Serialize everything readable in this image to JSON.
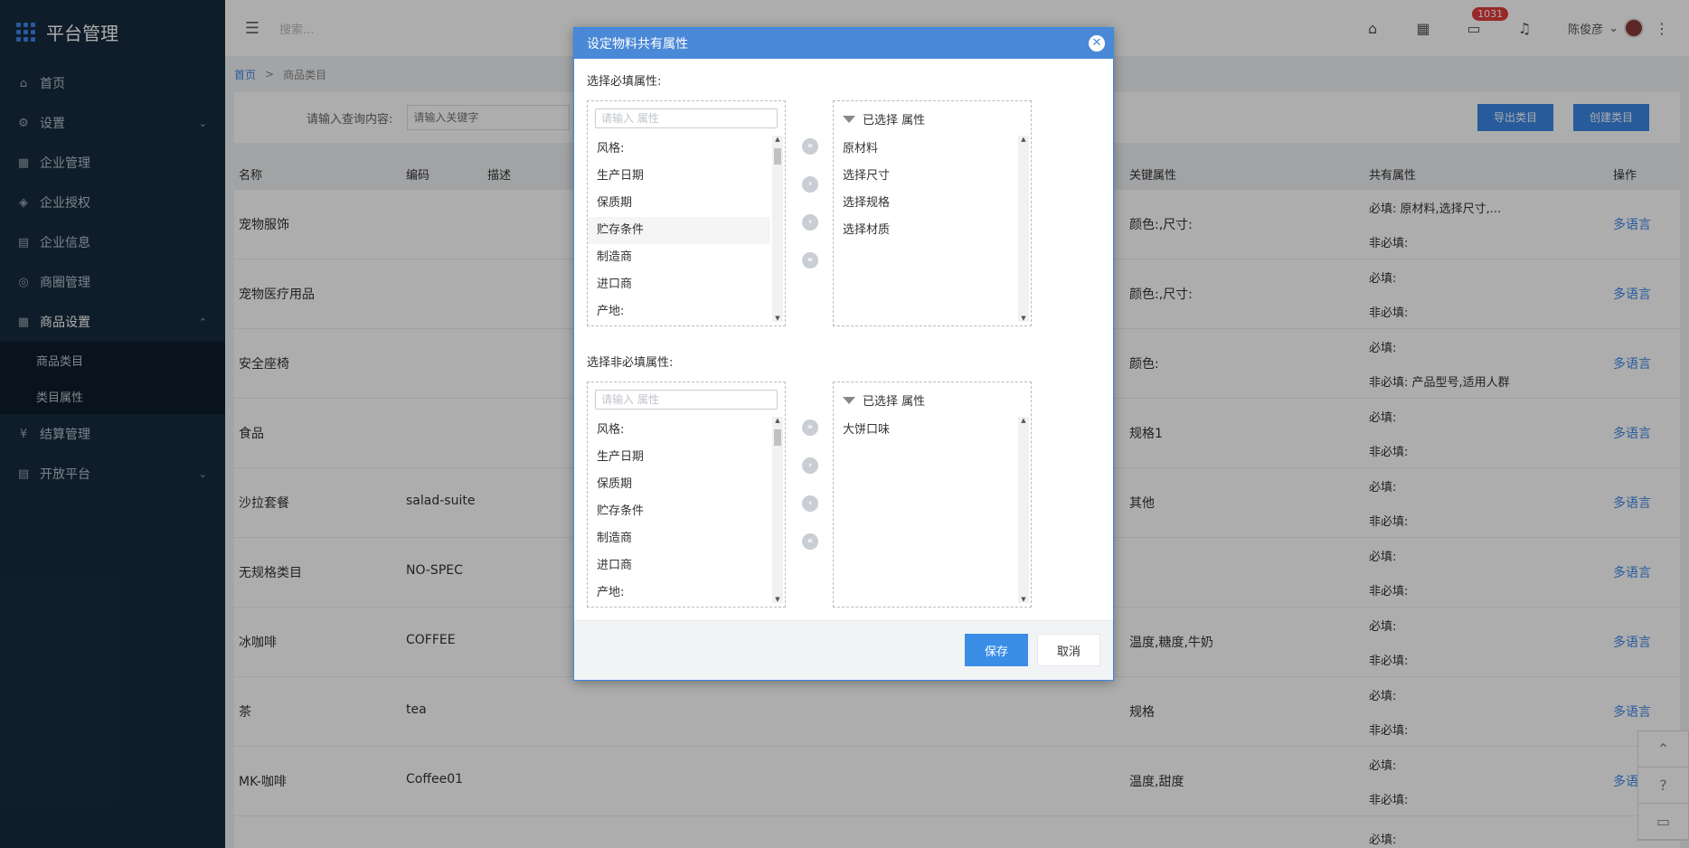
{
  "sidebar": {
    "brand": "平台管理",
    "items": [
      {
        "label": "首页",
        "icon": "⌂"
      },
      {
        "label": "设置",
        "icon": "⚙",
        "chevron": "⌄"
      },
      {
        "label": "企业管理",
        "icon": "▦"
      },
      {
        "label": "企业授权",
        "icon": "◈"
      },
      {
        "label": "企业信息",
        "icon": "▤"
      },
      {
        "label": "商圈管理",
        "icon": "◎"
      },
      {
        "label": "商品设置",
        "icon": "▦",
        "chevron": "⌃"
      },
      {
        "label": "结算管理",
        "icon": "¥"
      },
      {
        "label": "开放平台",
        "icon": "▤",
        "chevron": "⌄"
      }
    ],
    "sub_items": [
      "商品类目",
      "类目属性"
    ]
  },
  "header": {
    "menu_icon": "☰",
    "search_placeholder": "搜索...",
    "badge": "1031",
    "user": "陈俊彦",
    "user_chevron": "⌄",
    "more": "⋮"
  },
  "breadcrumb": {
    "home": "首页",
    "sep": ">",
    "current": "商品类目"
  },
  "filter": {
    "label": "请输入查询内容:",
    "placeholder": "请输入关键字",
    "export_label": "导出类目",
    "create_label": "创建类目"
  },
  "table": {
    "headers": {
      "name": "名称",
      "code": "编码",
      "desc": "描述",
      "key": "关键属性",
      "share": "共有属性",
      "op": "操作"
    },
    "rows": [
      {
        "name": "宠物服饰",
        "code": "",
        "key": "颜色:,尺寸:",
        "req": "必填: 原材料,选择尺寸,...",
        "opt": "非必填:",
        "op": "多语言"
      },
      {
        "name": "宠物医疗用品",
        "code": "",
        "key": "颜色:,尺寸:",
        "req": "必填:",
        "opt": "非必填:",
        "op": "多语言"
      },
      {
        "name": "安全座椅",
        "code": "",
        "key": "颜色:",
        "req": "必填:",
        "opt": "非必填: 产品型号,适用人群",
        "op": "多语言"
      },
      {
        "name": "食品",
        "code": "",
        "key": "规格1",
        "req": "必填:",
        "opt": "非必填:",
        "op": "多语言"
      },
      {
        "name": "沙拉套餐",
        "code": "salad-suite",
        "key": "其他",
        "req": "必填:",
        "opt": "非必填:",
        "op": "多语言"
      },
      {
        "name": "无规格类目",
        "code": "NO-SPEC",
        "key": "",
        "req": "必填:",
        "opt": "非必填:",
        "op": "多语言"
      },
      {
        "name": "冰咖啡",
        "code": "COFFEE",
        "key": "温度,糖度,牛奶",
        "req": "必填:",
        "opt": "非必填:",
        "op": "多语言"
      },
      {
        "name": "茶",
        "code": "tea",
        "key": "规格",
        "req": "必填:",
        "opt": "非必填:",
        "op": "多语言"
      },
      {
        "name": "MK-咖啡",
        "code": "Coffee01",
        "key": "温度,甜度",
        "req": "必填:",
        "opt": "非必填:",
        "op": "多语言"
      },
      {
        "name": "",
        "code": "",
        "key": "",
        "req": "必填:",
        "opt": "",
        "op": ""
      }
    ]
  },
  "modal": {
    "title": "设定物料共有属性",
    "close_icon": "✕",
    "required_label": "选择必填属性:",
    "optional_label": "选择非必填属性:",
    "search_placeholder": "请输入 属性",
    "selected_header": "已选择 属性",
    "required_available": [
      "风格:",
      "生产日期",
      "保质期",
      "贮存条件",
      "制造商",
      "进口商",
      "产地:"
    ],
    "required_selected": [
      "原材料",
      "选择尺寸",
      "选择规格",
      "选择材质"
    ],
    "optional_available": [
      "风格:",
      "生产日期",
      "保质期",
      "贮存条件",
      "制造商",
      "进口商",
      "产地:"
    ],
    "optional_selected": [
      "大饼口味"
    ],
    "arrows": [
      "»",
      "›",
      "‹",
      "«"
    ],
    "save_label": "保存",
    "cancel_label": "取消"
  },
  "float_tools": [
    "⌃",
    "?",
    "▭"
  ]
}
